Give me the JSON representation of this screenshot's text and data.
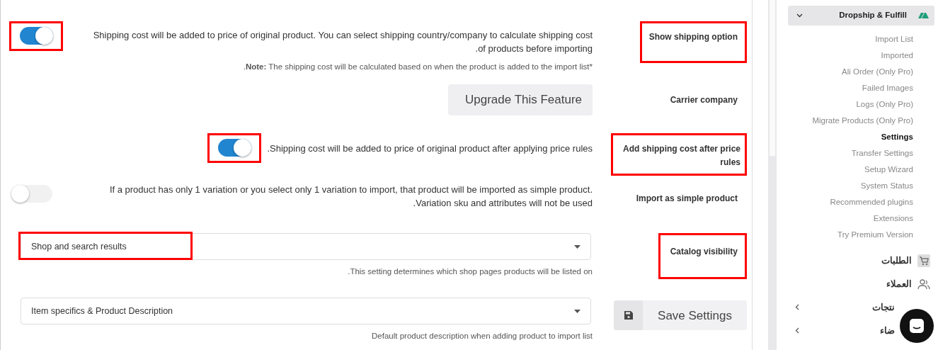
{
  "settings": [
    {
      "kind": "toggle",
      "label": "Show shipping option",
      "label_highlighted": true,
      "on": true,
      "control_highlighted": true,
      "description": "Shipping cost will be added to price of original product. You can select shipping country/company to calculate shipping cost of products before importing.",
      "note": {
        "lead": ".",
        "bold": "Note:",
        "text": "The shipping cost will be calculated based on when the product is added to the import list",
        "mark": "*"
      }
    },
    {
      "kind": "button",
      "label": "Carrier company",
      "label_highlighted": false,
      "button": "Upgrade This Feature"
    },
    {
      "kind": "toggle",
      "label": "Add shipping cost after price rules",
      "label_highlighted": true,
      "on": true,
      "control_highlighted": true,
      "description": "Shipping cost will be added to price of original product after applying price rules."
    },
    {
      "kind": "toggle",
      "label": "Import as simple product",
      "label_highlighted": false,
      "on": false,
      "control_highlighted": false,
      "description": "If a product has only 1 variation or you select only 1 variation to import, that product will be imported as simple product. Variation sku and attributes will not be used."
    },
    {
      "kind": "select",
      "label": "Catalog visibility",
      "label_highlighted": true,
      "value": "Shop and search results",
      "control_highlighted": true,
      "help": "This setting determines which shop pages products will be listed on."
    },
    {
      "kind": "select",
      "value": "Item specifics & Product Description",
      "control_highlighted": false,
      "help": "Default product description when adding product to import list",
      "save_button": "Save Settings"
    }
  ],
  "sidebar": {
    "header": "Dropship & Fulfill",
    "expanded": true,
    "items": [
      {
        "label": "Import List",
        "selected": false
      },
      {
        "label": "Imported",
        "selected": false
      },
      {
        "label": "Ali Order (Only Pro)",
        "selected": false
      },
      {
        "label": "Failed Images",
        "selected": false
      },
      {
        "label": "Logs (Only Pro)",
        "selected": false
      },
      {
        "label": "Migrate Products (Only Pro)",
        "selected": false
      },
      {
        "label": "Settings",
        "selected": true
      },
      {
        "label": "Transfer Settings",
        "selected": false
      },
      {
        "label": "Setup Wizard",
        "selected": false
      },
      {
        "label": "System Status",
        "selected": false
      },
      {
        "label": "Recommended plugins",
        "selected": false
      },
      {
        "label": "Extensions",
        "selected": false
      },
      {
        "label": "Try Premium Version",
        "selected": false
      }
    ],
    "menu": [
      {
        "label": "الطلبات",
        "kind": "cart",
        "submenu": false
      },
      {
        "label": "العملاء",
        "kind": "people",
        "submenu": false
      },
      {
        "label": "نتجات",
        "submenu": true
      },
      {
        "label": "ضاء",
        "submenu": true
      }
    ]
  }
}
